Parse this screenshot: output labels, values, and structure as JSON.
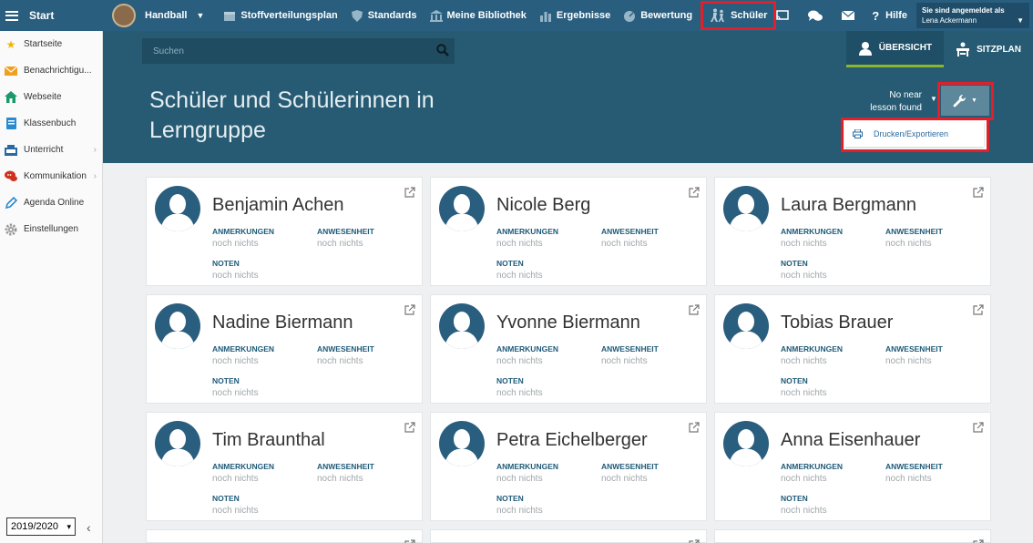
{
  "topbar": {
    "start_label": "Start",
    "group_label": "Handball",
    "nav": [
      {
        "label": "Stoffverteilungsplan",
        "icon": "calendar-icon"
      },
      {
        "label": "Standards",
        "icon": "shield-icon"
      },
      {
        "label": "Meine Bibliothek",
        "icon": "library-icon"
      },
      {
        "label": "Ergebnisse",
        "icon": "bar-chart-icon"
      },
      {
        "label": "Bewertung",
        "icon": "gauge-icon"
      },
      {
        "label": "Schüler",
        "icon": "students-icon"
      }
    ],
    "help_label": "Hilfe",
    "user_caption": "Sie sind angemeldet als",
    "user_name": "Lena Ackermann"
  },
  "sidebar": {
    "items": [
      {
        "label": "Startseite",
        "icon": "star-icon",
        "color": "#f0b400"
      },
      {
        "label": "Benachrichtigu...",
        "icon": "envelope-icon",
        "color": "#f0a020"
      },
      {
        "label": "Webseite",
        "icon": "house-icon",
        "color": "#1a9a6a"
      },
      {
        "label": "Klassenbuch",
        "icon": "book-icon",
        "color": "#2a8ad0"
      },
      {
        "label": "Unterricht",
        "icon": "school-icon",
        "color": "#2a6aa0"
      },
      {
        "label": "Kommunikation",
        "icon": "chat-icon",
        "color": "#d03020"
      },
      {
        "label": "Agenda Online",
        "icon": "pen-icon",
        "color": "#2a8ad0"
      },
      {
        "label": "Einstellungen",
        "icon": "gear-icon",
        "color": "#999999"
      }
    ],
    "year": "2019/2020"
  },
  "header": {
    "search_placeholder": "Suchen",
    "tabs": [
      {
        "label": "ÜBERSICHT"
      },
      {
        "label": "SITZPLAN"
      }
    ],
    "title": "Schüler und Schülerinnen in Lerngruppe",
    "lesson_text": "No near lesson found",
    "menu_item": "Drucken/Exportieren"
  },
  "labels": {
    "remarks": "ANMERKUNGEN",
    "attendance": "ANWESENHEIT",
    "grades": "NOTEN",
    "empty": "noch nichts"
  },
  "students": [
    {
      "name": "Benjamin Achen"
    },
    {
      "name": "Nicole Berg"
    },
    {
      "name": "Laura Bergmann"
    },
    {
      "name": "Nadine Biermann"
    },
    {
      "name": "Yvonne Biermann"
    },
    {
      "name": "Tobias Brauer"
    },
    {
      "name": "Tim Braunthal"
    },
    {
      "name": "Petra Eichelberger"
    },
    {
      "name": "Anna Eisenhauer"
    }
  ],
  "colors": {
    "topbar": "#2a5e7e",
    "header": "#265b73",
    "highlight": "#e0202a",
    "label": "#1e5a78"
  }
}
